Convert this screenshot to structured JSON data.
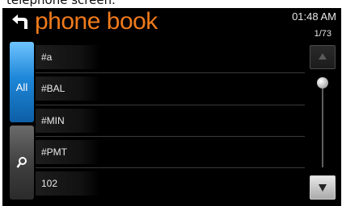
{
  "caption": "telephone  screen.",
  "header": {
    "title": "phone book",
    "clock": "01:48 AM",
    "count": "1/73"
  },
  "tabs": [
    {
      "label": "All",
      "state": "selected"
    },
    {
      "label": "",
      "icon": "search-icon"
    }
  ],
  "contacts": [
    "#a",
    "#BAL",
    "#MIN",
    "#PMT",
    "102"
  ],
  "scroll": {
    "up_icon": "triangle-up-icon",
    "down_icon": "triangle-down-icon",
    "position_fraction": 0.0
  },
  "colors": {
    "title": "#f07a1b",
    "tab_selected": "#1e87d8",
    "background": "#000000"
  }
}
